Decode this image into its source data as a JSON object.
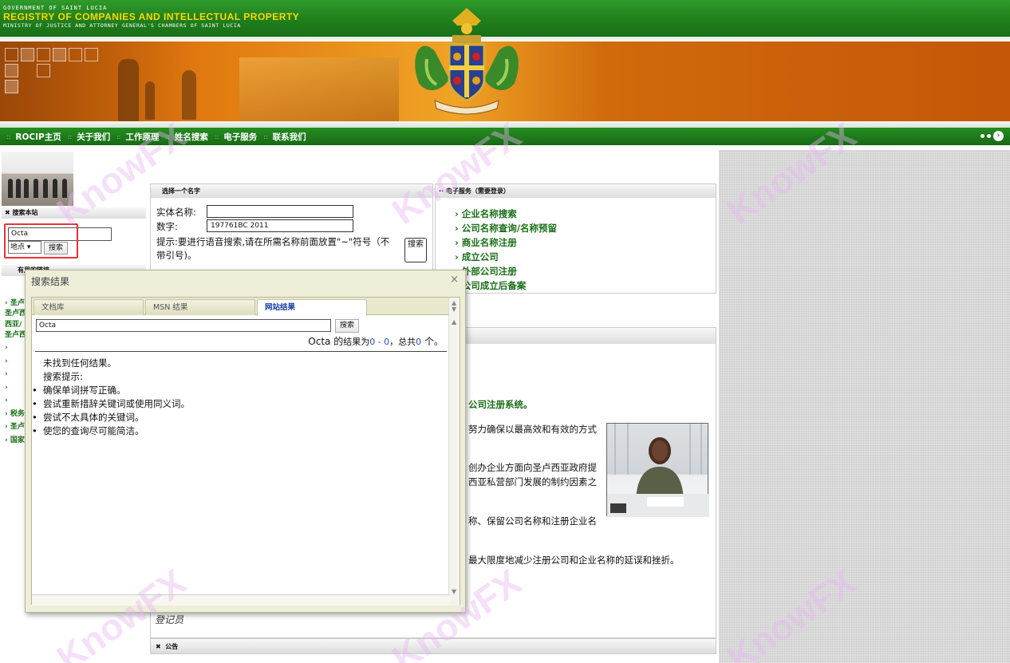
{
  "header": {
    "gov_line": "GOVERNMENT OF SAINT LUCIA",
    "title": "REGISTRY OF COMPANIES AND INTELLECTUAL PROPERTY",
    "subtitle": "MINISTRY OF JUSTICE AND ATTORNEY GENERAL'S CHAMBERS OF SAINT LUCIA"
  },
  "nav": [
    "ROCIP主页",
    "关于我们",
    "工作原理",
    "姓名搜索",
    "电子服务",
    "联系我们"
  ],
  "left": {
    "search_heading": "搜索本站",
    "search_value": "Octa",
    "location_option": "地点",
    "search_button": "搜索",
    "links_heading": "有用的链接",
    "links": [
      "圣卢",
      "圣卢西",
      "西亚/",
      "圣卢西",
      "",
      "",
      "",
      "",
      "",
      "税务",
      "圣卢",
      "国家"
    ]
  },
  "name_box": {
    "heading": "选择一个名字",
    "entity_label": "实体名称:",
    "entity_value": "",
    "number_label": "数字:",
    "number_value": "197761BC 2011",
    "hint": "提示:要进行语音搜索,请在所需名称前面放置\"~\"符号（不带引号)。",
    "search_button": "搜索"
  },
  "eservices": {
    "heading": "电子服务（需要登录）",
    "links": [
      "企业名称搜索",
      "公司名称查询/名称预留",
      "商业名称注册",
      "成立公司",
      "外部公司注册",
      "公司成立后备案"
    ]
  },
  "main": {
    "frag1": "公司注册系统。",
    "frag2": "努力确保以最高效和有效的方式",
    "frag3": "创办企业方面向圣卢西亚政府提",
    "frag4": "西亚私营部门发展的制约因素之",
    "frag5": "称、保留公司名称和注册企业名",
    "frag6": "最大限度地减少注册公司和企业名称的延误和挫折。",
    "registrar": "登记员",
    "notice": "公告"
  },
  "dialog": {
    "title": "搜索结果",
    "close": "×",
    "tabs": [
      "文档库",
      "MSN 结果",
      "网站结果"
    ],
    "search_value": "Octa",
    "search_button": "搜索",
    "result_query": "Octa 的",
    "result_mid": "结果为",
    "result_range": "0 - 0",
    "result_total_label": "，总共",
    "result_total": "0",
    "result_unit": " 个。",
    "no_result": "未找到任何结果。",
    "tips_heading": "搜索提示:",
    "tips": [
      "确保单词拼写正确。",
      "尝试重新措辞关键词或使用同义词。",
      "尝试不太具体的关键词。",
      "使您的查询尽可能简洁。"
    ]
  },
  "watermark": "KnowFX"
}
